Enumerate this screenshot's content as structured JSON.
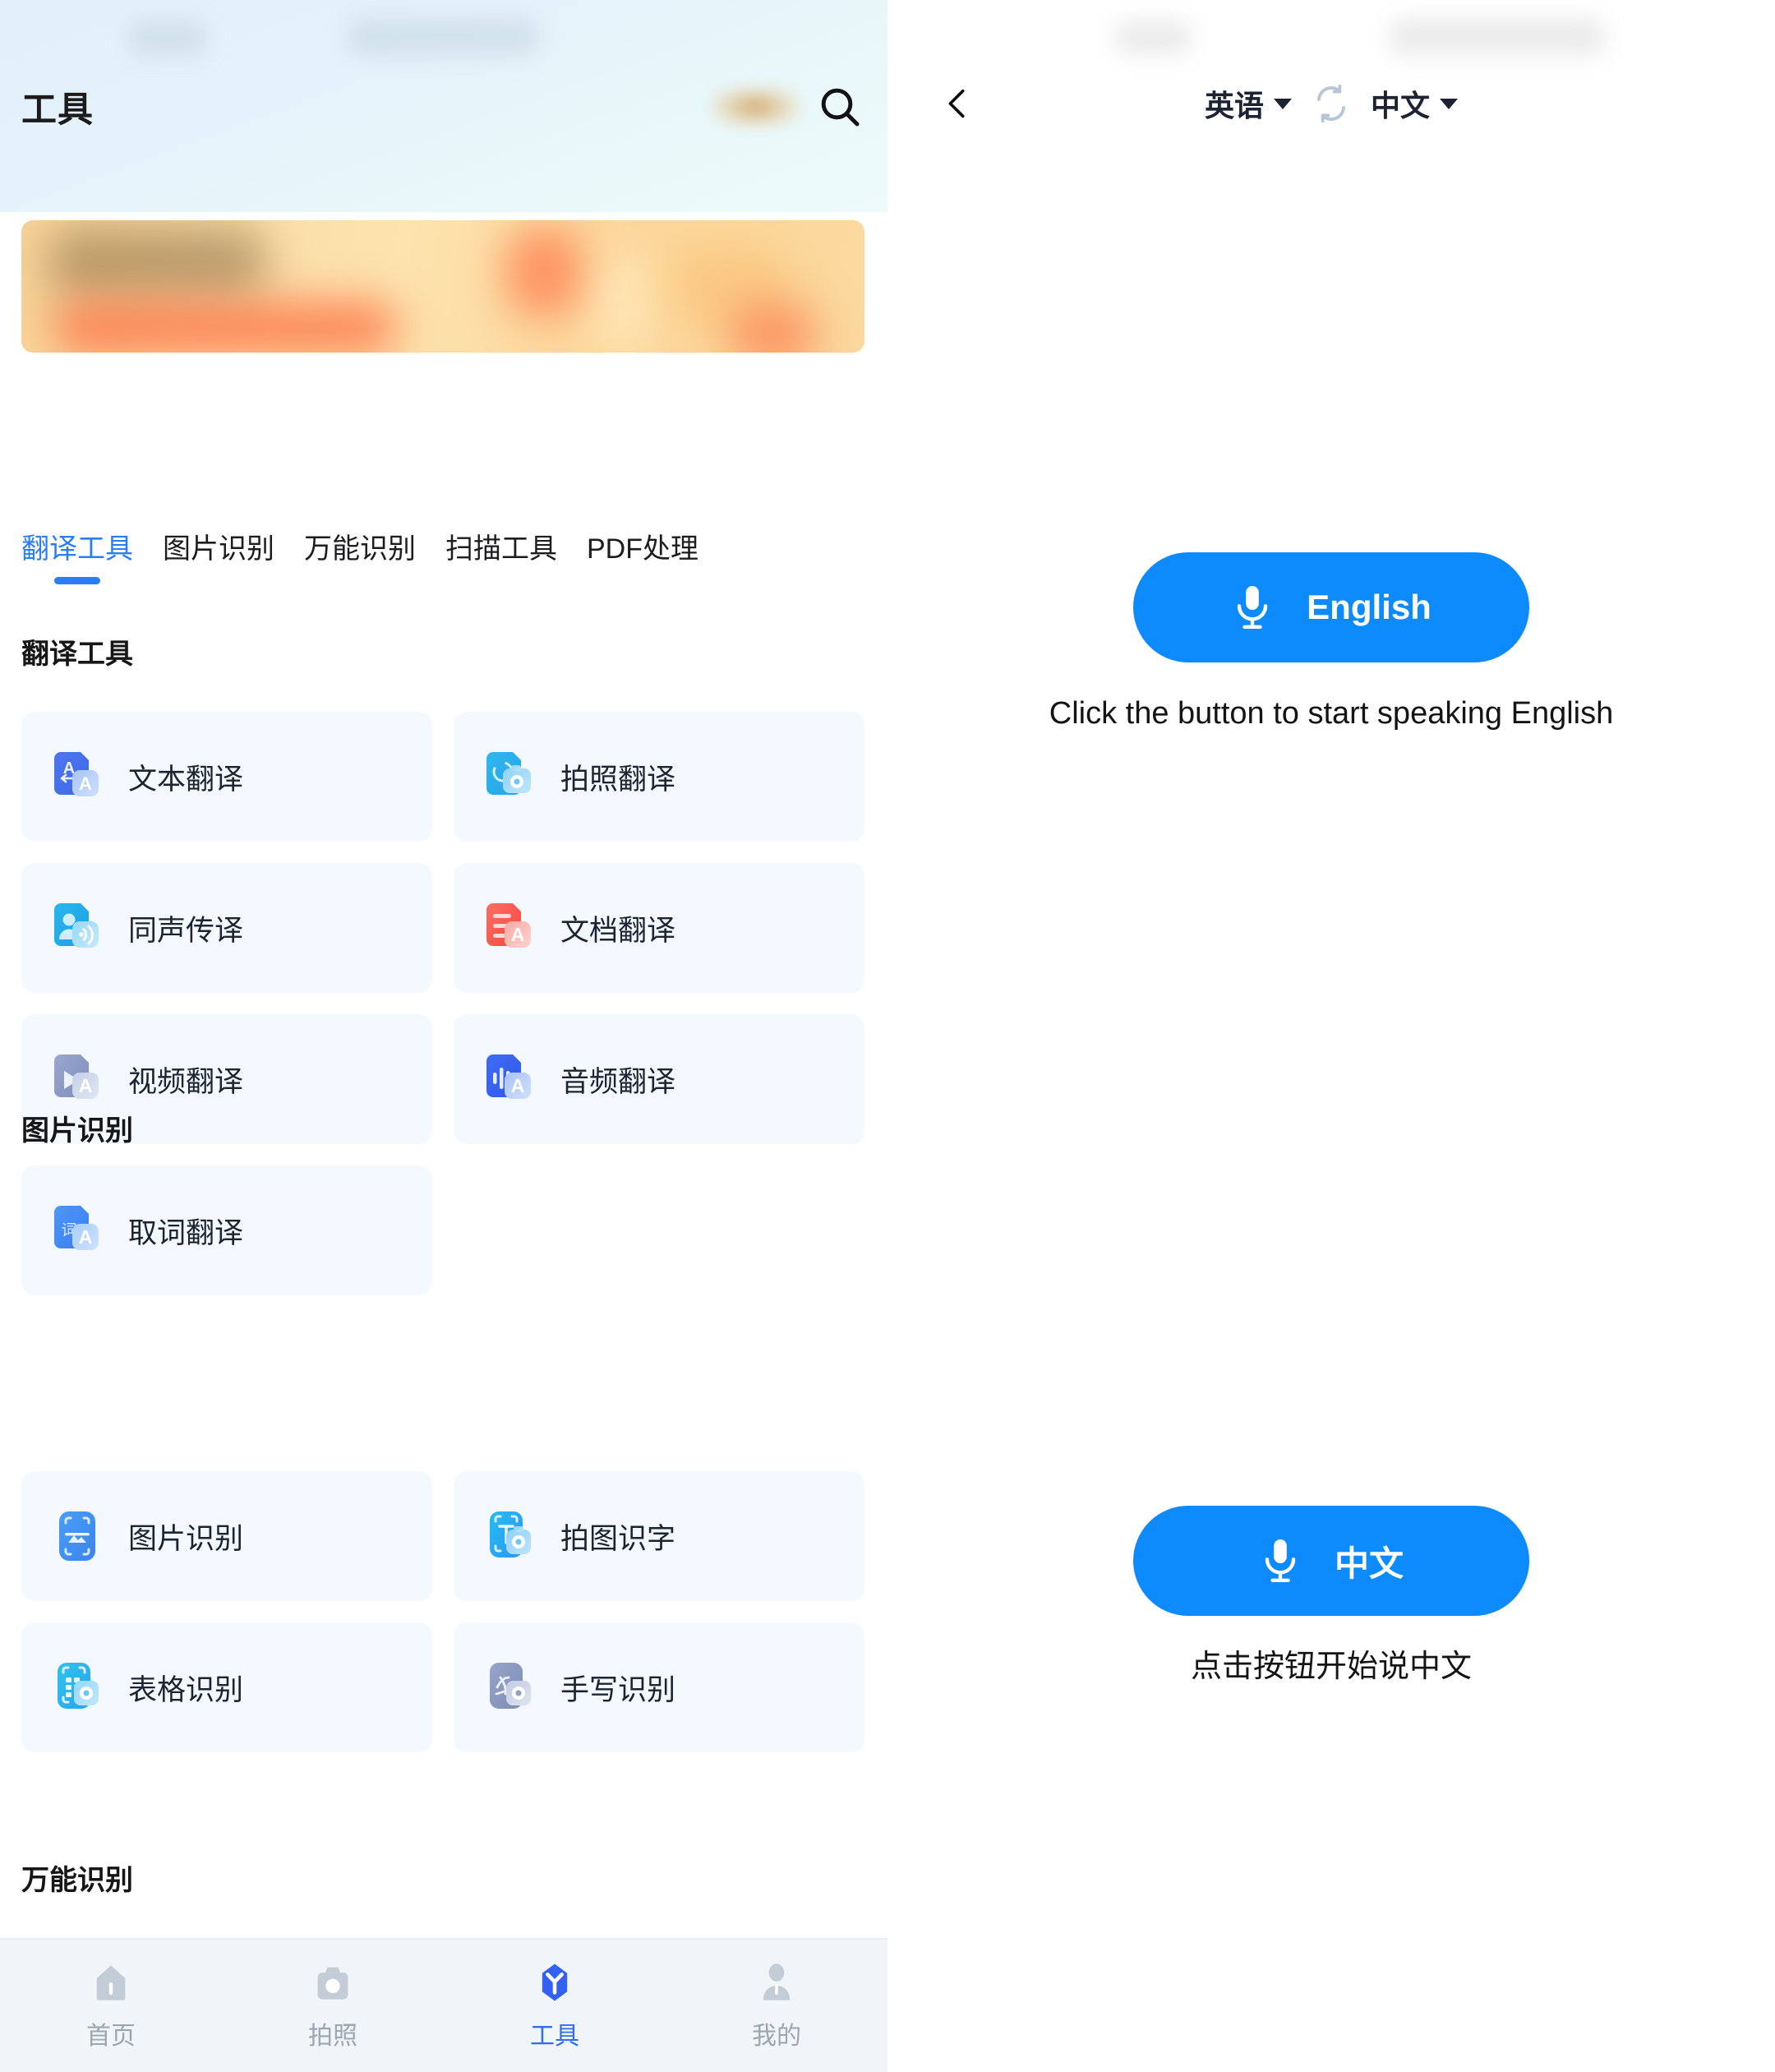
{
  "left": {
    "header": {
      "title": "工具",
      "search_icon": "search-icon",
      "badge_icon": "blurred-badge"
    },
    "banner": {
      "alt": "promotional-banner"
    },
    "tabs": [
      {
        "label": "翻译工具",
        "active": true
      },
      {
        "label": "图片识别",
        "active": false
      },
      {
        "label": "万能识别",
        "active": false
      },
      {
        "label": "扫描工具",
        "active": false
      },
      {
        "label": "PDF处理",
        "active": false
      }
    ],
    "sections": [
      {
        "heading": "翻译工具",
        "cards": [
          {
            "label": "文本翻译",
            "icon": "text-translate-icon"
          },
          {
            "label": "拍照翻译",
            "icon": "photo-translate-icon"
          },
          {
            "label": "同声传译",
            "icon": "simultaneous-interpretation-icon"
          },
          {
            "label": "文档翻译",
            "icon": "document-translate-icon"
          },
          {
            "label": "视频翻译",
            "icon": "video-translate-icon"
          },
          {
            "label": "音频翻译",
            "icon": "audio-translate-icon"
          },
          {
            "label": "取词翻译",
            "icon": "word-pick-translate-icon"
          }
        ]
      },
      {
        "heading": "图片识别",
        "cards": [
          {
            "label": "图片识别",
            "icon": "image-recognition-icon"
          },
          {
            "label": "拍图识字",
            "icon": "photo-ocr-icon"
          },
          {
            "label": "表格识别",
            "icon": "table-recognition-icon"
          },
          {
            "label": "手写识别",
            "icon": "handwriting-recognition-icon"
          }
        ]
      },
      {
        "heading": "万能识别",
        "cards": []
      }
    ],
    "bottom_nav": [
      {
        "label": "首页",
        "icon": "home-icon",
        "active": false
      },
      {
        "label": "拍照",
        "icon": "camera-icon",
        "active": false
      },
      {
        "label": "工具",
        "icon": "tools-icon",
        "active": true
      },
      {
        "label": "我的",
        "icon": "profile-icon",
        "active": false
      }
    ]
  },
  "right": {
    "header": {
      "back_icon": "chevron-left-icon",
      "source_language": "英语",
      "swap_icon": "swap-languages-icon",
      "target_language": "中文"
    },
    "top_mic": {
      "icon": "microphone-icon",
      "label": "English",
      "hint": "Click the button to start speaking English"
    },
    "bottom_mic": {
      "icon": "microphone-icon",
      "label": "中文",
      "hint": "点击按钮开始说中文"
    }
  },
  "colors": {
    "accent_blue": "#0d8bfc",
    "tab_active": "#2a7df4",
    "card_bg": "#f4f9ff",
    "nav_bg": "#f1f5f8",
    "nav_inactive": "#9aa6b2"
  }
}
